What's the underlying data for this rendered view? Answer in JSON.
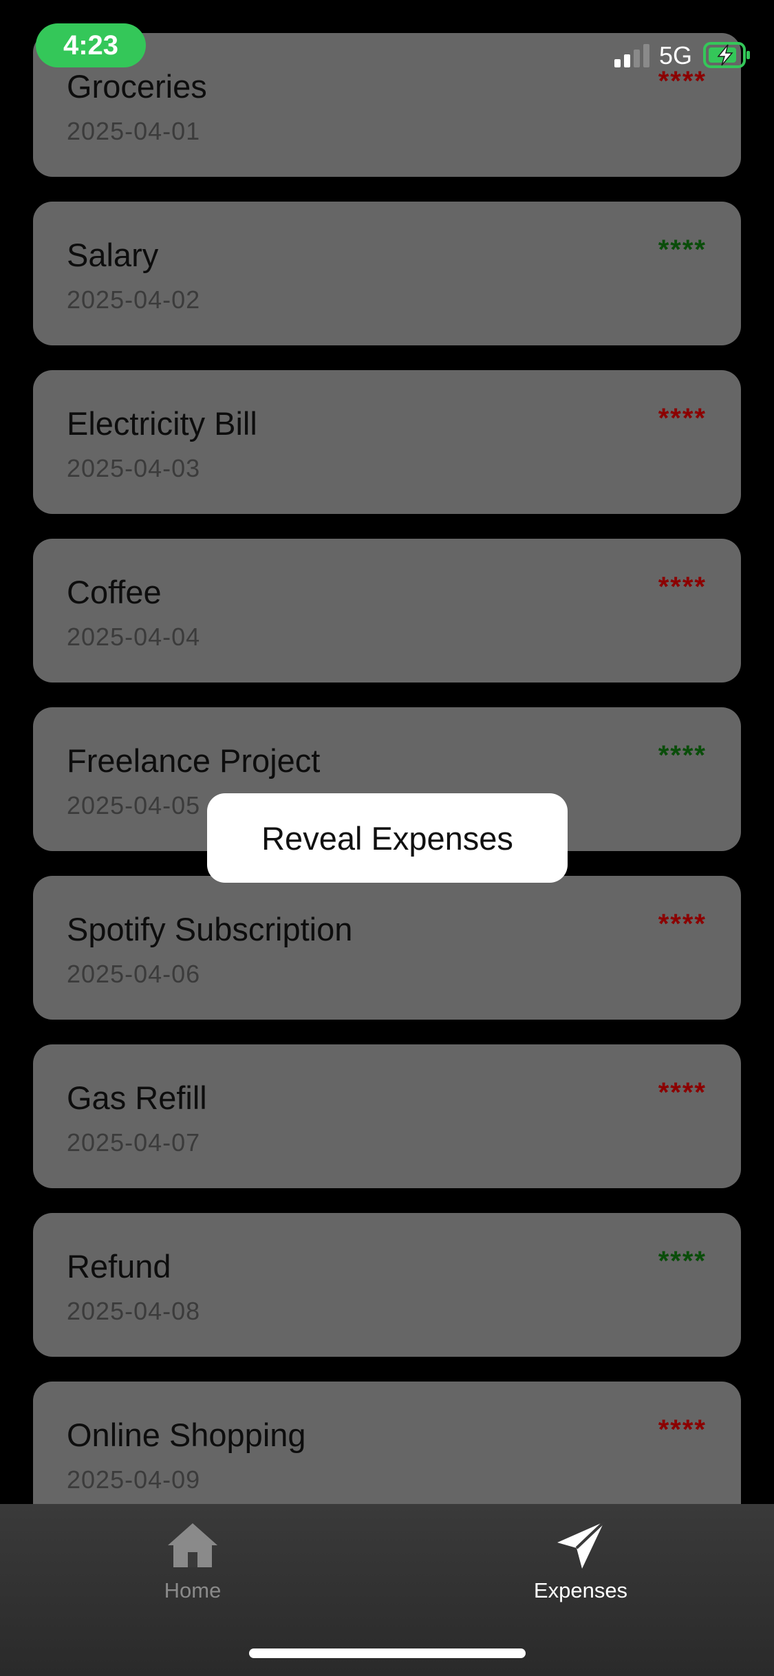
{
  "status_bar": {
    "time": "4:23",
    "network": "5G"
  },
  "colors": {
    "card_bg": "#666666",
    "expense_amount": "#8b0000",
    "income_amount": "#0a4d0a",
    "time_pill": "#34c759"
  },
  "transactions": [
    {
      "title": "Groceries",
      "date": "2025-04-01",
      "amount": "****",
      "type": "expense"
    },
    {
      "title": "Salary",
      "date": "2025-04-02",
      "amount": "****",
      "type": "income"
    },
    {
      "title": "Electricity Bill",
      "date": "2025-04-03",
      "amount": "****",
      "type": "expense"
    },
    {
      "title": "Coffee",
      "date": "2025-04-04",
      "amount": "****",
      "type": "expense"
    },
    {
      "title": "Freelance Project",
      "date": "2025-04-05",
      "amount": "****",
      "type": "income"
    },
    {
      "title": "Spotify Subscription",
      "date": "2025-04-06",
      "amount": "****",
      "type": "expense"
    },
    {
      "title": "Gas Refill",
      "date": "2025-04-07",
      "amount": "****",
      "type": "expense"
    },
    {
      "title": "Refund",
      "date": "2025-04-08",
      "amount": "****",
      "type": "income"
    },
    {
      "title": "Online Shopping",
      "date": "2025-04-09",
      "amount": "****",
      "type": "expense"
    }
  ],
  "reveal_button": {
    "label": "Reveal Expenses"
  },
  "tab_bar": {
    "tabs": [
      {
        "label": "Home",
        "icon": "house-icon",
        "active": false
      },
      {
        "label": "Expenses",
        "icon": "paper-plane-icon",
        "active": true
      }
    ]
  }
}
